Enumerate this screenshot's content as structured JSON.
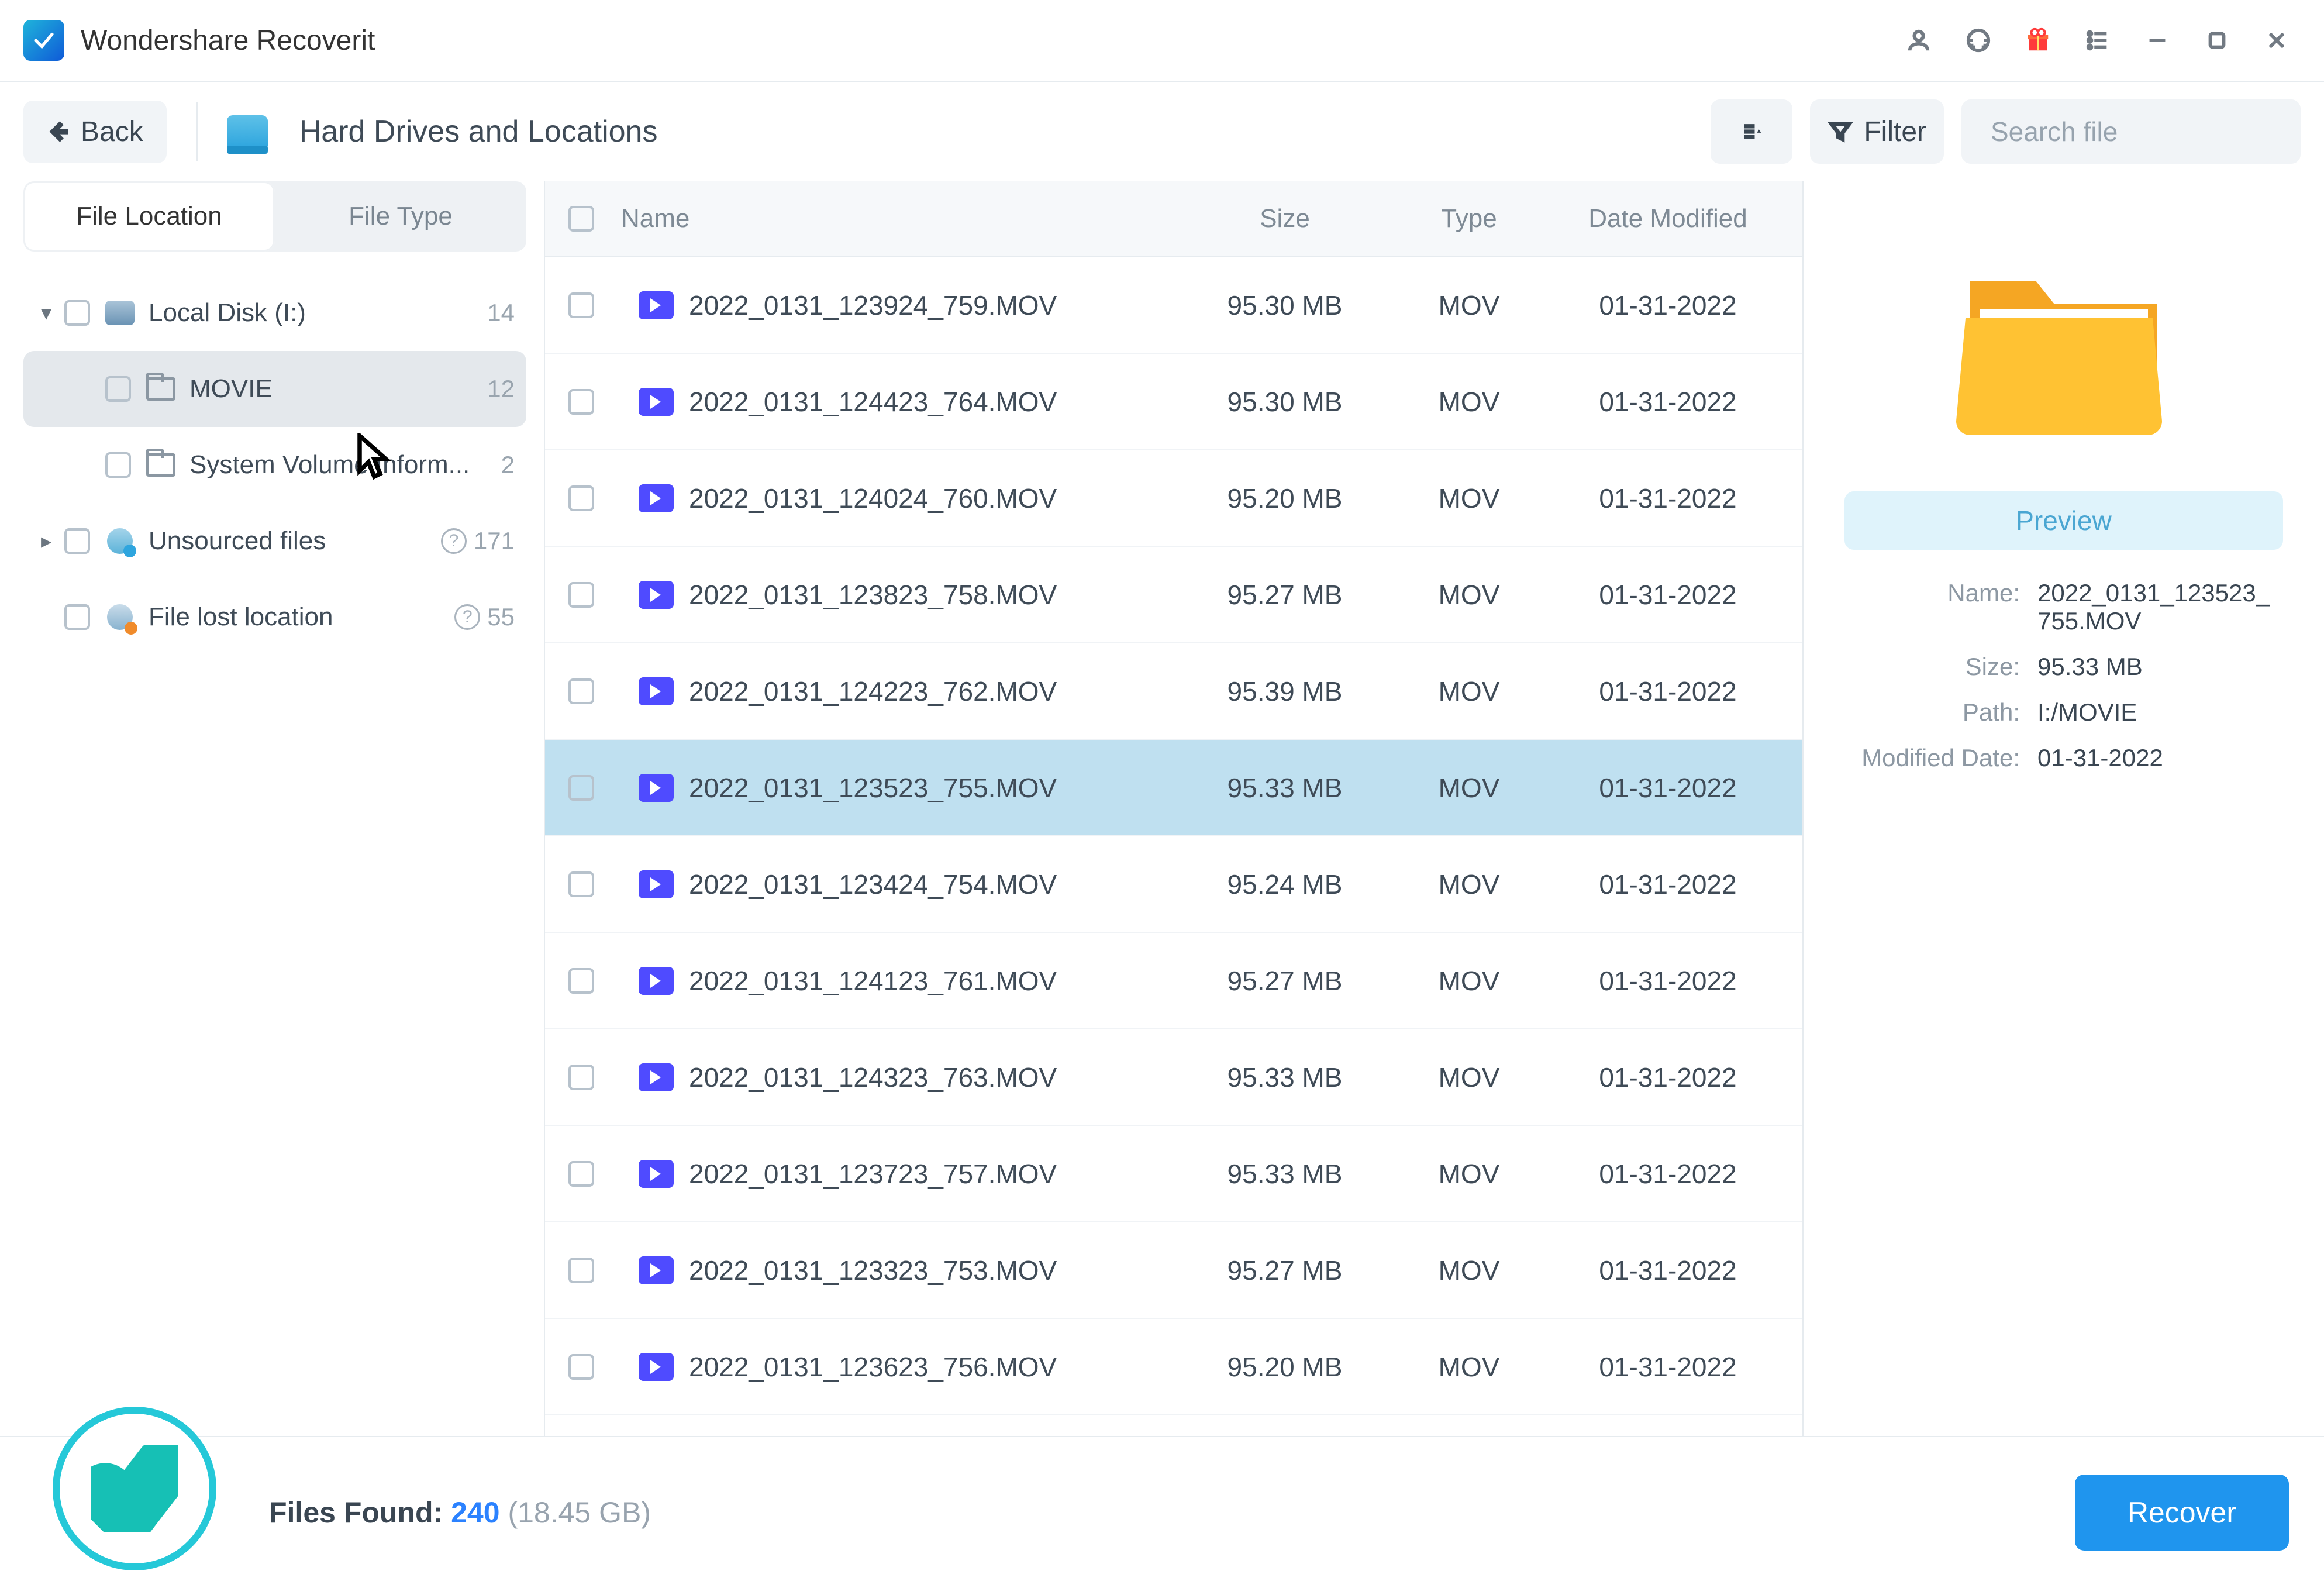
{
  "app": {
    "title": "Wondershare Recoverit"
  },
  "toolbar": {
    "back": "Back",
    "location": "Hard Drives and Locations",
    "filter": "Filter",
    "search_placeholder": "Search file"
  },
  "sidebar": {
    "tabs": {
      "location": "File Location",
      "type": "File Type"
    },
    "tree": [
      {
        "kind": "disk",
        "label": "Local Disk (I:)",
        "count": "14",
        "depth": 0,
        "expand": "▾"
      },
      {
        "kind": "folder",
        "label": "MOVIE",
        "count": "12",
        "depth": 1,
        "selected": true
      },
      {
        "kind": "folder",
        "label": "System Volume Inform...",
        "count": "2",
        "depth": 1
      },
      {
        "kind": "pin",
        "label": "Unsourced files",
        "count": "171",
        "depth": 0,
        "help": true,
        "expand": "▸"
      },
      {
        "kind": "loc",
        "label": "File lost location",
        "count": "55",
        "depth": 0,
        "help": true
      }
    ]
  },
  "columns": {
    "name": "Name",
    "size": "Size",
    "type": "Type",
    "date": "Date Modified"
  },
  "files": [
    {
      "name": "2022_0131_123924_759.MOV",
      "size": "95.30 MB",
      "type": "MOV",
      "date": "01-31-2022"
    },
    {
      "name": "2022_0131_124423_764.MOV",
      "size": "95.30 MB",
      "type": "MOV",
      "date": "01-31-2022"
    },
    {
      "name": "2022_0131_124024_760.MOV",
      "size": "95.20 MB",
      "type": "MOV",
      "date": "01-31-2022"
    },
    {
      "name": "2022_0131_123823_758.MOV",
      "size": "95.27 MB",
      "type": "MOV",
      "date": "01-31-2022"
    },
    {
      "name": "2022_0131_124223_762.MOV",
      "size": "95.39 MB",
      "type": "MOV",
      "date": "01-31-2022"
    },
    {
      "name": "2022_0131_123523_755.MOV",
      "size": "95.33 MB",
      "type": "MOV",
      "date": "01-31-2022",
      "selected": true
    },
    {
      "name": "2022_0131_123424_754.MOV",
      "size": "95.24 MB",
      "type": "MOV",
      "date": "01-31-2022"
    },
    {
      "name": "2022_0131_124123_761.MOV",
      "size": "95.27 MB",
      "type": "MOV",
      "date": "01-31-2022"
    },
    {
      "name": "2022_0131_124323_763.MOV",
      "size": "95.33 MB",
      "type": "MOV",
      "date": "01-31-2022"
    },
    {
      "name": "2022_0131_123723_757.MOV",
      "size": "95.33 MB",
      "type": "MOV",
      "date": "01-31-2022"
    },
    {
      "name": "2022_0131_123323_753.MOV",
      "size": "95.27 MB",
      "type": "MOV",
      "date": "01-31-2022"
    },
    {
      "name": "2022_0131_123623_756.MOV",
      "size": "95.20 MB",
      "type": "MOV",
      "date": "01-31-2022"
    }
  ],
  "details": {
    "preview_btn": "Preview",
    "labels": {
      "name": "Name:",
      "size": "Size:",
      "path": "Path:",
      "modified": "Modified Date:"
    },
    "name": "2022_0131_123523_755.MOV",
    "size": "95.33 MB",
    "path": "I:/MOVIE",
    "modified": "01-31-2022"
  },
  "footer": {
    "found_label": "Files Found:",
    "found_count": "240",
    "found_size": "(18.45 GB)",
    "recover": "Recover"
  }
}
